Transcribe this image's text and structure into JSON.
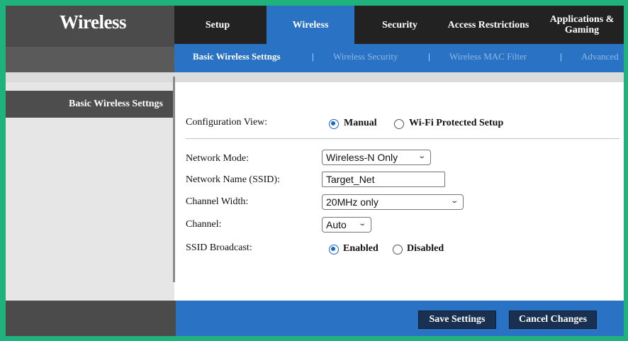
{
  "header": {
    "title": "Wireless",
    "tabs": [
      {
        "label": "Setup"
      },
      {
        "label": "Wireless"
      },
      {
        "label": "Security"
      },
      {
        "label": "Access Restrictions"
      },
      {
        "label": "Applications & Gaming"
      }
    ]
  },
  "subnav": {
    "items": [
      "Basic Wireless Settngs",
      "Wireless Security",
      "Wireless MAC Filter",
      "Advanced"
    ],
    "separator": "|"
  },
  "sidebar": {
    "heading": "Basic Wireless Settngs"
  },
  "form": {
    "config_view": {
      "label": "Configuration View:",
      "options": [
        "Manual",
        "Wi-Fi Protected Setup"
      ],
      "selected": "Manual"
    },
    "network_mode": {
      "label": "Network Mode:",
      "value": "Wireless-N Only"
    },
    "ssid": {
      "label": "Network Name (SSID):",
      "value": "Target_Net"
    },
    "channel_width": {
      "label": "Channel Width:",
      "value": "20MHz only"
    },
    "channel": {
      "label": "Channel:",
      "value": "Auto"
    },
    "ssid_broadcast": {
      "label": "SSID Broadcast:",
      "options": [
        "Enabled",
        "Disabled"
      ],
      "selected": "Enabled"
    }
  },
  "footer": {
    "save_label": "Save Settings",
    "cancel_label": "Cancel Changes"
  },
  "colors": {
    "accent_blue": "#2a72c3",
    "header_dark": "#222222",
    "radio_selected": "#1a66c9",
    "border_green": "#1fb27d"
  }
}
